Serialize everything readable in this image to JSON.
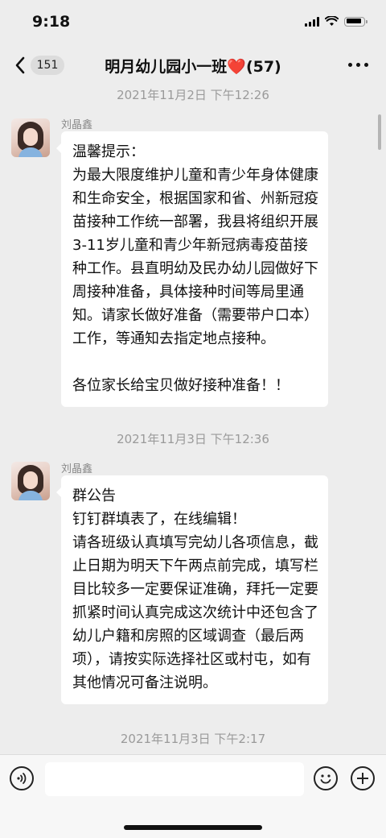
{
  "status_bar": {
    "time": "9:18"
  },
  "header": {
    "unread_count": "151",
    "title": "明月幼儿园小一班",
    "title_emoji": "❤️",
    "member_count": "(57)"
  },
  "messages": [
    {
      "timestamp": "2021年11月2日 下午12:26",
      "sender": "刘晶鑫",
      "text": "温馨提示：\n为最大限度维护儿童和青少年身体健康和生命安全，根据国家和省、州新冠疫苗接种工作统一部署，我县将组织开展3-11岁儿童和青少年新冠病毒疫苗接种工作。县直明幼及民办幼儿园做好下周接种准备，具体接种时间等局里通知。请家长做好准备（需要带户口本）工作，等通知去指定地点接种。\n\n各位家长给宝贝做好接种准备！！"
    },
    {
      "timestamp": "2021年11月3日 下午12:36",
      "sender": "刘晶鑫",
      "text": "群公告\n钉钉群填表了，在线编辑！\n请各班级认真填写完幼儿各项信息，截止日期为明天下午两点前完成，填写栏目比较多一定要保证准确，拜托一定要抓紧时间认真完成这次统计中还包含了幼儿户籍和房照的区域调查（最后两项），请按实际选择社区或村屯，如有其他情况可备注说明。"
    },
    {
      "timestamp": "2021年11月3日 下午2:17"
    }
  ],
  "input_bar": {
    "placeholder": ""
  },
  "icons": {
    "back": "chevron-left-icon",
    "more": "more-dots-icon",
    "voice": "voice-icon",
    "emoji": "emoji-icon",
    "plus": "plus-icon"
  }
}
